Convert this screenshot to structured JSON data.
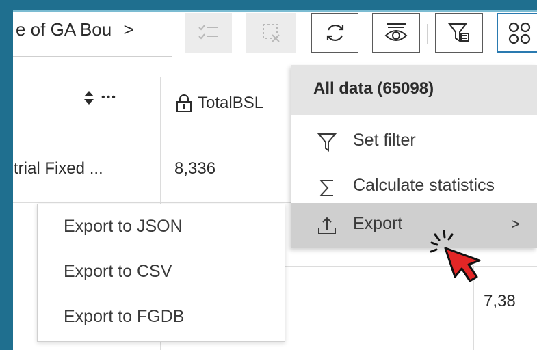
{
  "toolbar": {
    "breadcrumb_text": "e of GA Bou",
    "breadcrumb_chevron": ">",
    "buttons": [
      "select-all-icon",
      "clear-selection-icon",
      "refresh-icon",
      "show-hide-icon",
      "filter-by-extent-icon",
      "layout-icon"
    ]
  },
  "table": {
    "sort_more": "•••",
    "column_header": "TotalBSL",
    "row1": {
      "col1": "trial Fixed ...",
      "col2": "8,336"
    },
    "row2": {
      "col3": "7,38"
    }
  },
  "context_menu": {
    "header": "All data (65098)",
    "items": [
      {
        "label": "Set filter",
        "icon": "filter-icon"
      },
      {
        "label": "Calculate statistics",
        "icon": "sigma-icon"
      },
      {
        "label": "Export",
        "icon": "export-icon",
        "chevron": ">"
      }
    ]
  },
  "export_submenu": {
    "items": [
      "Export to JSON",
      "Export to CSV",
      "Export to FGDB"
    ]
  },
  "colors": {
    "frame": "#1f6f8f",
    "menu_header_bg": "#e4e4e4",
    "hover_bg": "#cfcfcf",
    "cursor": "#e32626",
    "active_border": "#2a7ab0"
  }
}
